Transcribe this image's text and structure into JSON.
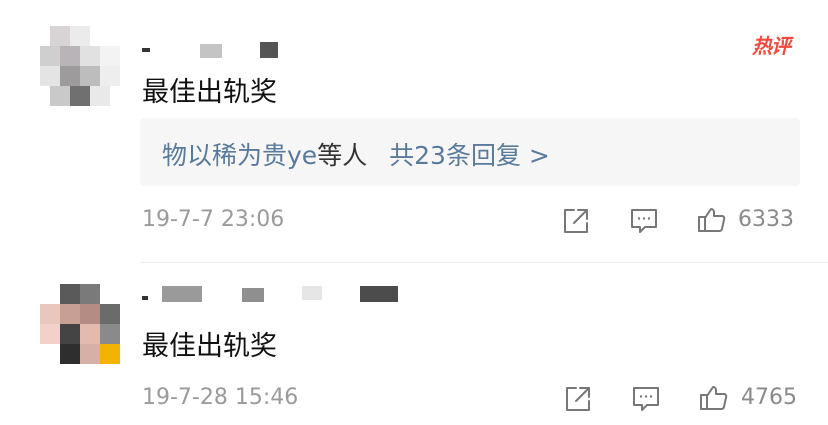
{
  "comments": [
    {
      "text": "最佳出轨奖",
      "hot_badge": "热评",
      "reply_summary": {
        "names": "物以稀为贵ye",
        "mid": "等人",
        "count_text": "共23条回复 >"
      },
      "time": "19-7-7 23:06",
      "likes": "6333",
      "icons": [
        "share-icon",
        "comment-icon",
        "like-icon"
      ]
    },
    {
      "text": "最佳出轨奖",
      "time": "19-7-28 15:46",
      "likes": "4765",
      "icons": [
        "share-icon",
        "comment-icon",
        "like-icon"
      ]
    }
  ],
  "colors": {
    "link_blue": "#5a7a9c",
    "hot_red": "#f24a3c",
    "meta_gray": "#9a9a9a",
    "reply_bg": "#f6f6f6"
  }
}
